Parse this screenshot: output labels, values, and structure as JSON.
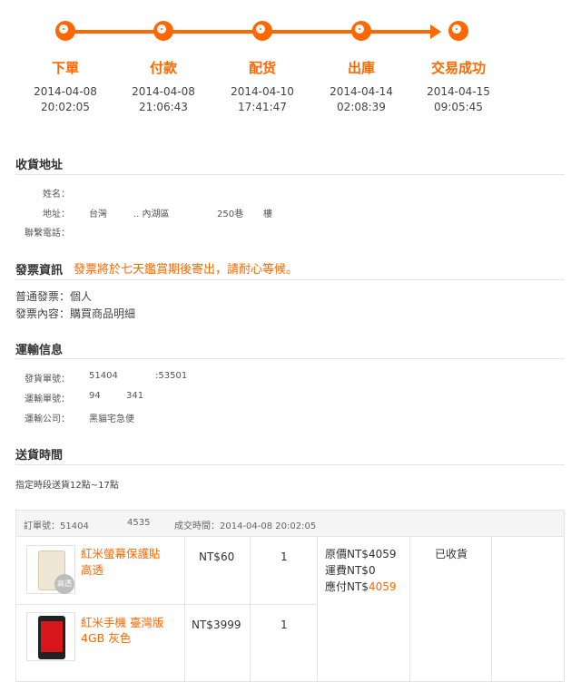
{
  "steps": [
    {
      "label": "下單",
      "date": "2014-04-08",
      "time": "20:02:05"
    },
    {
      "label": "付款",
      "date": "2014-04-08",
      "time": "21:06:43"
    },
    {
      "label": "配货",
      "date": "2014-04-10",
      "time": "17:41:47"
    },
    {
      "label": "出庫",
      "date": "2014-04-14",
      "time": "02:08:39"
    },
    {
      "label": "交易成功",
      "date": "2014-04-15",
      "time": "09:05:45"
    }
  ],
  "address": {
    "title": "收貨地址",
    "name_key": "姓名：",
    "addr_key": "地址：",
    "addr_region": "台灣",
    "addr_district": ".. 內湖區",
    "addr_no": "250巷",
    "addr_floor": "樓",
    "phone_key": "聯繫電話："
  },
  "invoice": {
    "title": "發票資訊",
    "notice": "發票將於七天鑑賞期後寄出，請耐心等候。",
    "line1": "普通發票：個人",
    "line2": "發票內容：購買商品明細"
  },
  "shipping": {
    "title": "運輸信息",
    "ship_no_key": "發貨單號：",
    "ship_no_a": "51404",
    "ship_no_b": ":53501",
    "track_no_key": "運輸單號：",
    "track_no_a": "94",
    "track_no_b": "341",
    "carrier_key": "運輸公司：",
    "carrier": "黑貓宅急便"
  },
  "delivery": {
    "title": "送貨時間",
    "text": "指定時段送貨12點~17點"
  },
  "order": {
    "number_label": "訂單號：51404",
    "number_tail": "4535",
    "time_label": "成交時間：2014-04-08 20:02:05",
    "items": [
      {
        "name_l1": "紅米螢幕保護貼",
        "name_l2": "高透",
        "price": "NT$60",
        "qty": "1",
        "thumb_tag": "高透"
      },
      {
        "name_l1": "紅米手機 臺灣版",
        "name_l2": "4GB 灰色",
        "price": "NT$3999",
        "qty": "1"
      }
    ],
    "original": "原價NT$4059",
    "freight": "運費NT$0",
    "payable_prefix": "應付NT$",
    "payable_amount": "4059",
    "status": "已收貨"
  },
  "colors": {
    "accent": "#ff6700",
    "rule": "#e5e5e5",
    "head_bg": "#f5f5f5"
  }
}
